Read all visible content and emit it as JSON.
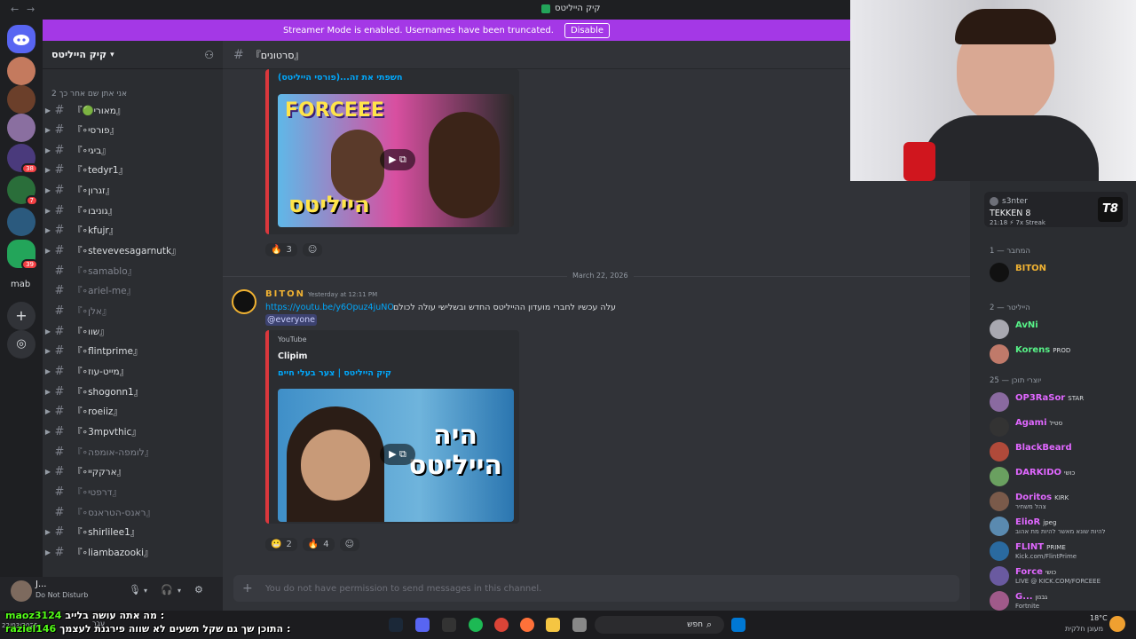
{
  "window": {
    "title": "קיק הייליטס",
    "back": "←",
    "forward": "→"
  },
  "banner": {
    "text": "Streamer Mode is enabled. Usernames have been truncated.",
    "button": "Disable",
    "color": "#a438e6"
  },
  "server_rail": {
    "label_mab": "mab",
    "badges": [
      "38",
      "7",
      "39"
    ]
  },
  "guild": {
    "name": "קיק הייליטס",
    "category": "אני אתן שם אחר כך 2",
    "channels": [
      {
        "name": "『🟢מאורי』",
        "muted": false
      },
      {
        "name": "『∘פורסי』",
        "muted": false
      },
      {
        "name": "『∘ביגי』",
        "muted": false
      },
      {
        "name": "『∘tedyr1』",
        "muted": false
      },
      {
        "name": "『∘זגרון』",
        "muted": false
      },
      {
        "name": "『∘גוניבו』",
        "muted": false
      },
      {
        "name": "『∘kfujr』",
        "muted": false
      },
      {
        "name": "『∘stevevesagarnutk』",
        "muted": false
      },
      {
        "name": "『∘samablo』",
        "muted": true
      },
      {
        "name": "『∘ariel-me』",
        "muted": true
      },
      {
        "name": "『∘אלן』",
        "muted": true
      },
      {
        "name": "『∘שוו』",
        "muted": false
      },
      {
        "name": "『∘flintprime』",
        "muted": false
      },
      {
        "name": "『∘מייט-עוז』",
        "muted": false
      },
      {
        "name": "『∘shogonn1』",
        "muted": false
      },
      {
        "name": "『∘roeiiz』",
        "muted": false
      },
      {
        "name": "『∘3mpvthic』",
        "muted": false
      },
      {
        "name": "『∘לומפה-אומפה』",
        "muted": true
      },
      {
        "name": "『∘ארקקיי』",
        "muted": false
      },
      {
        "name": "『∘דרפטי』",
        "muted": true
      },
      {
        "name": "『∘ראנס-הטראנס』",
        "muted": true
      },
      {
        "name": "『∘shirlilee1』",
        "muted": false
      },
      {
        "name": "『∘liambazooki』",
        "muted": false
      }
    ]
  },
  "user_panel": {
    "name": "J...",
    "status": "Do Not Disturb"
  },
  "chat": {
    "channel_name": "『סרטונים』",
    "top_embed": {
      "link": "חשפתי את זה...(פורסי הייליטס)"
    },
    "reactions_top": [
      {
        "emoji": "🔥",
        "count": "3"
      }
    ],
    "date_divider": "March 22, 2026",
    "message": {
      "author": "BITON",
      "timestamp": "Yesterday at 12:11 PM",
      "url": "https://youtu.be/y6Opuz4juNO",
      "text": "עלה עכשיו לחברי מועדון ההייליטס החדש ובשלישי עולה לכולם",
      "mention": "@everyone",
      "embed": {
        "provider": "YouTube",
        "title": "Clipim",
        "link": "קיק הייליטס | צער בעלי חיים"
      },
      "thumbnail_text": "היה הייליטס"
    },
    "top_thumb_text_top": "FORCEEE",
    "top_thumb_text_bottom": "הייליטס",
    "reactions_bottom": [
      {
        "emoji": "😬",
        "count": "2"
      },
      {
        "emoji": "🔥",
        "count": "4"
      }
    ],
    "composer_placeholder": "You do not have permission to send messages in this channel."
  },
  "members": {
    "now_playing": {
      "name": "s3nter",
      "game": "TEKKEN 8",
      "meta": "21:18 ⚡ 7x Streak"
    },
    "groups": [
      {
        "title": "המחבר — 1",
        "members": [
          {
            "name": "BITON",
            "color": "#f0b232",
            "tag": "",
            "sub": ""
          }
        ]
      },
      {
        "title": "הייליטר — 2",
        "members": [
          {
            "name": "AvNi",
            "color": "#57f287",
            "tag": "",
            "sub": ""
          },
          {
            "name": "Korens",
            "color": "#57f287",
            "tag": "PROD",
            "sub": ""
          }
        ]
      },
      {
        "title": "יוצרי תוכן — 25",
        "members": [
          {
            "name": "OP3RaSor",
            "color": "#e067ff",
            "tag": "STAR",
            "sub": ""
          },
          {
            "name": "Agami",
            "color": "#e067ff",
            "tag": "סטיל",
            "sub": ""
          },
          {
            "name": "BlackBeard",
            "color": "#e067ff",
            "tag": "",
            "sub": ""
          },
          {
            "name": "DARKIDO",
            "color": "#e067ff",
            "tag": "כושי",
            "sub": ""
          },
          {
            "name": "Doritos",
            "color": "#e067ff",
            "tag": "KIRK",
            "sub": "צהל משחיר"
          },
          {
            "name": "ElioR",
            "color": "#e067ff",
            "tag": "jpeg",
            "sub": "להיות שונא מאשר להיות מת אהוב"
          },
          {
            "name": "FLINT",
            "color": "#e067ff",
            "tag": "PRIME",
            "sub": "Kick.com/FlintPrime"
          },
          {
            "name": "Force",
            "color": "#e067ff",
            "tag": "כושי",
            "sub": "LIVE @ KICK.COM/FORCEEE"
          },
          {
            "name": "G...",
            "color": "#e067ff",
            "tag": "גבנון",
            "sub": "Fortnite"
          }
        ]
      }
    ]
  },
  "overlay_chat": [
    {
      "user": "maoz3124",
      "text": "מה אתה עושה בלייב :"
    },
    {
      "user": "raziel146",
      "text": "התוכן שך גם שקל תשעים לא שווה פירגנת לעצמך :"
    }
  ],
  "taskbar": {
    "search": "חפש",
    "weather": "18°C",
    "weather_sub": "מעונן חלקית",
    "lang": "עבר",
    "time": "12:1",
    "date": "22/03/2026"
  }
}
